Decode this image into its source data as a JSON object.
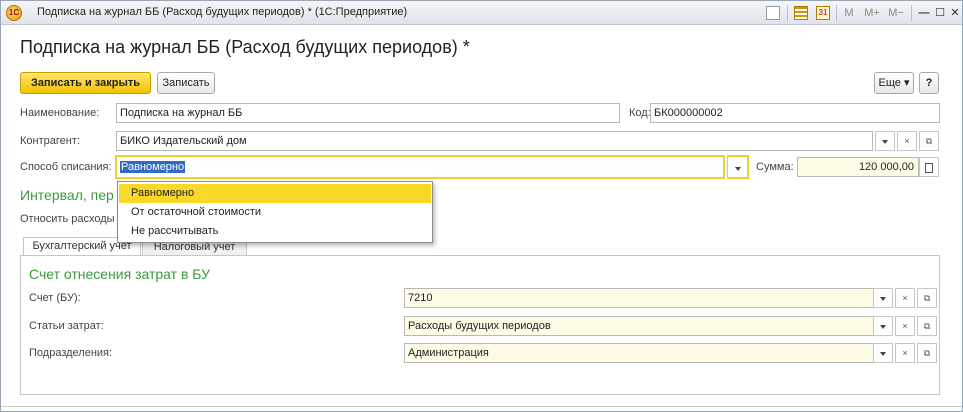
{
  "window": {
    "title": "Подписка на журнал ББ (Расход будущих периодов) * (1С:Предприятие)",
    "logo_text": "1С",
    "toolbar_icons": [
      "doc-icon",
      "calculator-icon",
      "calendar-icon",
      "M",
      "M+",
      "M-",
      "minimize-icon",
      "maximize-icon",
      "close-icon"
    ],
    "calendar_day": "31",
    "mem_labels": {
      "m": "M",
      "mplus": "M+",
      "mminus": "M−"
    },
    "controls": {
      "minimize": "—",
      "maximize": "☐",
      "close": "✕"
    }
  },
  "form": {
    "title": "Подписка на журнал ББ (Расход будущих периодов) *",
    "buttons": {
      "save_close": "Записать и закрыть",
      "save": "Записать",
      "more": "Еще ▾",
      "help": "?"
    },
    "fields": {
      "name_label": "Наименование:",
      "name_value": "Подписка на журнал ББ",
      "code_label": "Код:",
      "code_value": "БК000000002",
      "contractor_label": "Контрагент:",
      "contractor_value": "БИКО Издательский дом",
      "method_label": "Способ списания:",
      "method_value": "Равномерно",
      "sum_label": "Сумма:",
      "sum_value": "120 000,00"
    },
    "interval_heading": "Интервал, пер",
    "attribute_label": "Относить расходы"
  },
  "dropdown": {
    "options": [
      "Равномерно",
      "От остаточной стоимости",
      "Не рассчитывать"
    ],
    "selected_index": 0
  },
  "tabs": {
    "items": [
      "Бухгалтерский учет",
      "Налоговый учет"
    ],
    "active_index": 0,
    "section_heading": "Счет отнесения затрат в БУ",
    "rows": [
      {
        "label": "Счет (БУ):",
        "value": "7210"
      },
      {
        "label": "Статьи затрат:",
        "value": "Расходы будущих периодов"
      },
      {
        "label": "Подразделения:",
        "value": "Администрация"
      }
    ]
  },
  "field_buttons": {
    "clear": "×",
    "open": "⧉"
  },
  "colors": {
    "accent_yellow": "#f9d827",
    "heading_green": "#3a9a3a",
    "field_yellow": "#fdfbe6"
  }
}
